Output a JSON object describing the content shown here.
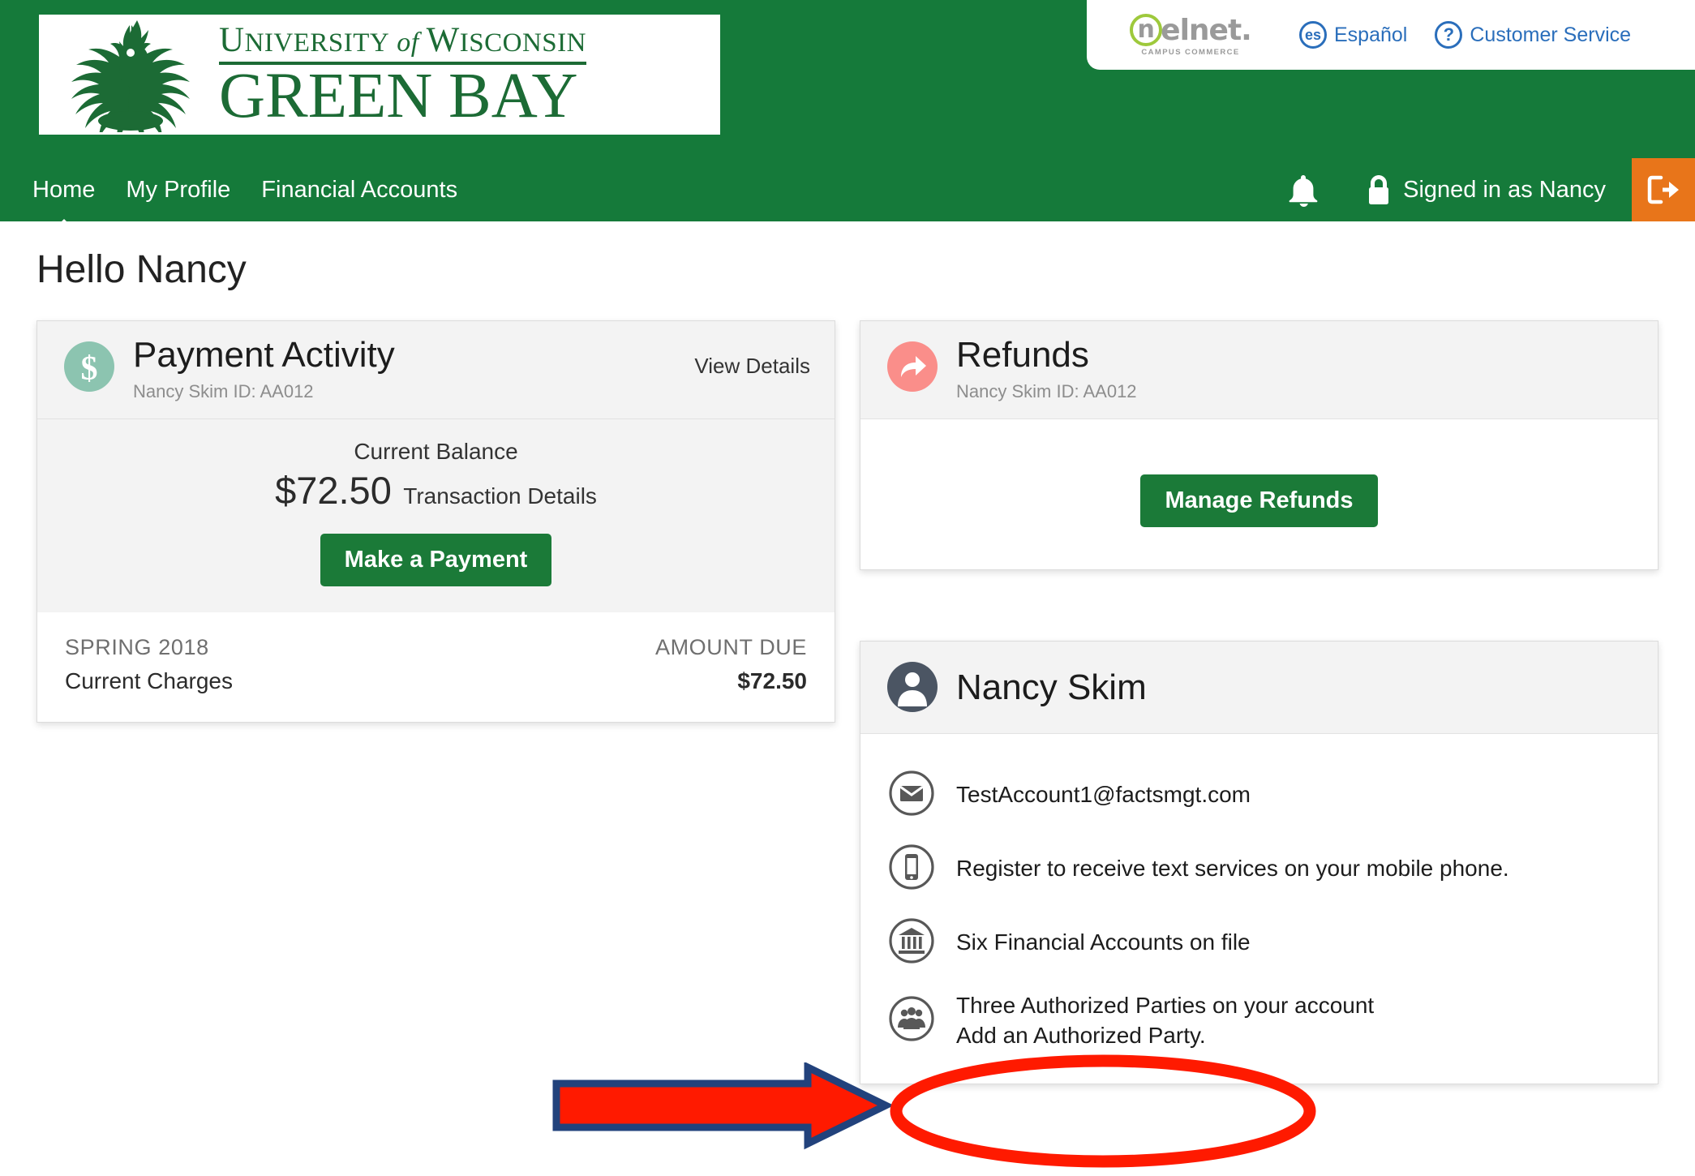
{
  "header": {
    "logo_line1_parts": [
      "U",
      "NIVERSITY",
      " of ",
      "W",
      "ISCONSIN"
    ],
    "logo_line1_text": "University of Wisconsin",
    "logo_line2_text": "GREEN BAY",
    "logo_alt": "University of Wisconsin Green Bay phoenix logo"
  },
  "banner": {
    "brand_n": "n",
    "brand_rest": "elnet.",
    "brand_sub": "CAMPUS COMMERCE",
    "espanol_badge": "es",
    "espanol_label": "Español",
    "help_badge": "?",
    "help_label": "Customer Service"
  },
  "nav": {
    "items": [
      {
        "label": "Home",
        "active": true
      },
      {
        "label": "My Profile",
        "active": false
      },
      {
        "label": "Financial Accounts",
        "active": false
      }
    ],
    "signed_in_text": "Signed in as Nancy",
    "bell_name": "notifications-bell-icon",
    "lock_name": "lock-icon",
    "signout_name": "sign-out-icon"
  },
  "page": {
    "greeting": "Hello Nancy"
  },
  "payment_activity": {
    "title": "Payment Activity",
    "subtitle": "Nancy Skim ID: AA012",
    "view_details": "View Details",
    "balance_label": "Current Balance",
    "balance_amount": "$72.50",
    "transaction_details": "Transaction Details",
    "make_payment": "Make a Payment",
    "term": "SPRING 2018",
    "charges_label": "Current Charges",
    "amount_due_label": "AMOUNT DUE",
    "amount_due": "$72.50",
    "icon_color": "#8CC4B0"
  },
  "refunds": {
    "title": "Refunds",
    "subtitle": "Nancy Skim ID: AA012",
    "manage_button": "Manage Refunds",
    "icon_color": "#FA8E8A"
  },
  "profile": {
    "name": "Nancy Skim",
    "items": [
      {
        "icon": "envelope-icon",
        "text": "TestAccount1@factsmgt.com",
        "sub": ""
      },
      {
        "icon": "mobile-phone-icon",
        "text": "Register to receive text services on your mobile phone.",
        "sub": ""
      },
      {
        "icon": "bank-icon",
        "text": "Six Financial Accounts on file",
        "sub": ""
      },
      {
        "icon": "people-group-icon",
        "text": "Three Authorized Parties on your account",
        "sub": "Add an Authorized Party."
      }
    ]
  },
  "annotations": {
    "arrow_fill": "#FF1A00",
    "arrow_stroke": "#22427C",
    "ellipse_color": "#FF1A00"
  },
  "colors": {
    "brand_green": "#157A3A",
    "button_green": "#1B7A38",
    "signout_orange": "#E8751A",
    "link_blue": "#2a6ebb",
    "nelnet_lime": "#9ec93c"
  }
}
